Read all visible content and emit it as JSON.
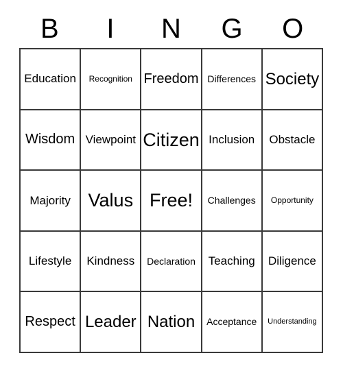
{
  "card": {
    "header_letters": [
      "B",
      "I",
      "N",
      "G",
      "O"
    ],
    "rows": [
      [
        {
          "text": "Education",
          "size": "fs-md"
        },
        {
          "text": "Recognition",
          "size": "fs-xs"
        },
        {
          "text": "Freedom",
          "size": "fs-lg"
        },
        {
          "text": "Differences",
          "size": "fs-sm"
        },
        {
          "text": "Society",
          "size": "fs-xl"
        }
      ],
      [
        {
          "text": "Wisdom",
          "size": "fs-lg"
        },
        {
          "text": "Viewpoint",
          "size": "fs-md"
        },
        {
          "text": "Citizen",
          "size": "fs-xxl"
        },
        {
          "text": "Inclusion",
          "size": "fs-md"
        },
        {
          "text": "Obstacle",
          "size": "fs-md"
        }
      ],
      [
        {
          "text": "Majority",
          "size": "fs-md"
        },
        {
          "text": "Valus",
          "size": "fs-xxl"
        },
        {
          "text": "Free!",
          "size": "fs-xxl"
        },
        {
          "text": "Challenges",
          "size": "fs-sm"
        },
        {
          "text": "Opportunity",
          "size": "fs-xs"
        }
      ],
      [
        {
          "text": "Lifestyle",
          "size": "fs-md"
        },
        {
          "text": "Kindness",
          "size": "fs-md"
        },
        {
          "text": "Declaration",
          "size": "fs-sm"
        },
        {
          "text": "Teaching",
          "size": "fs-md"
        },
        {
          "text": "Diligence",
          "size": "fs-md"
        }
      ],
      [
        {
          "text": "Respect",
          "size": "fs-lg"
        },
        {
          "text": "Leader",
          "size": "fs-xl"
        },
        {
          "text": "Nation",
          "size": "fs-xl"
        },
        {
          "text": "Acceptance",
          "size": "fs-sm"
        },
        {
          "text": "Understanding",
          "size": "fs-xxs"
        }
      ]
    ]
  },
  "colors": {
    "background": "#ffffff",
    "text": "#000000",
    "grid_line": "#3a3a3a"
  }
}
